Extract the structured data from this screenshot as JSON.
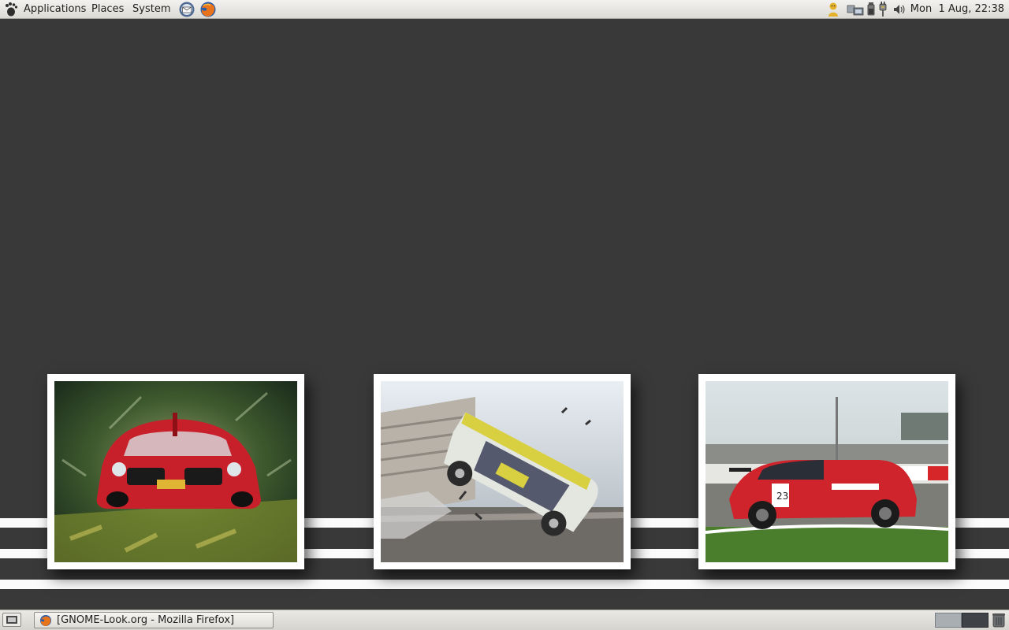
{
  "top_panel": {
    "menus": {
      "applications": "Applications",
      "places": "Places",
      "system": "System"
    },
    "launchers": [
      "email-client-icon",
      "firefox-icon"
    ],
    "tray_icons": [
      "user-status-icon",
      "network-icon",
      "battery-icon",
      "power-plug-icon",
      "volume-icon"
    ],
    "clock": "Mon  1 Aug, 22:38"
  },
  "desktop": {
    "background_color": "#393939",
    "photos": [
      {
        "icon": "red-muscle-car-photo"
      },
      {
        "icon": "crashing-rally-car-photo"
      },
      {
        "icon": "red-race-car-photo"
      }
    ]
  },
  "bottom_panel": {
    "task": {
      "label": "[GNOME-Look.org - Mozilla Firefox]",
      "icon": "firefox-icon"
    },
    "workspaces": [
      "workspace-1",
      "workspace-2"
    ]
  }
}
